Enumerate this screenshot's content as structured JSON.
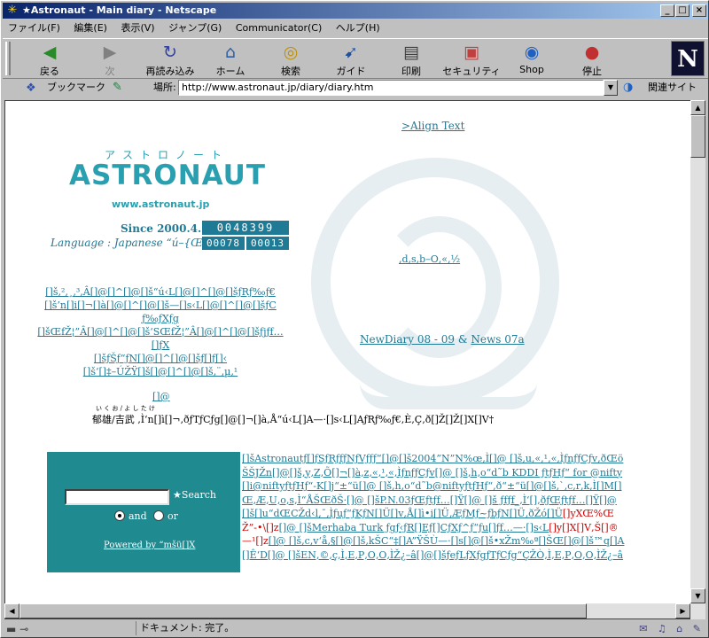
{
  "window": {
    "title": "★Astronaut - Main diary - Netscape",
    "buttons": {
      "minimize": "_",
      "maximize": "□",
      "close": "×"
    }
  },
  "menu": [
    "ファイル(F)",
    "編集(E)",
    "表示(V)",
    "ジャンプ(G)",
    "Communicator(C)",
    "ヘルプ(H)"
  ],
  "toolbar": {
    "back": "戻る",
    "forward": "次",
    "reload": "再読み込み",
    "home": "ホーム",
    "search": "検索",
    "guide": "ガイド",
    "print": "印刷",
    "security": "セキュリティ",
    "shop": "Shop",
    "stop": "停止",
    "brand": "N"
  },
  "location": {
    "bookmarks": "ブックマーク",
    "label": "場所:",
    "url": "http://www.astronaut.jp/diary/diary.htm",
    "related": "関連サイト"
  },
  "status": {
    "text": "ドキュメント: 完了。"
  },
  "page": {
    "align_text": ">Align Text",
    "logo": {
      "kana": "アストロノート",
      "wordmark": "ASTRONAUT",
      "site": "www.astronaut.jp"
    },
    "since": "Since 2000.4.1",
    "counter": "0048399",
    "language": "Language : Japanese “ú–{Œê",
    "counter_today": "00078",
    "counter_yesterday": "00013",
    "menu_links": [
      "[]š‚²‚¸‚³‚Â[]@[]^[]@[]š“ú‹L[]@[]^[]@[]šƒRƒ‰ƒ€",
      "[]š’n[]i[]¬[]à[]@[]^[]@[]š—[]s‹L[]@[]^[]@[]šƒC",
      "ƒ‰ƒXƒg",
      "[]šŒfŽ¦”Â[]@[]^[]@[]š‘SŒfŽ¦”Â[]@[]^[]@[]šƒjƒf…",
      "[]ƒX",
      "[]šƒŠƒ“ƒN[]@[]^[]@[]šƒ[]ƒ[]‹",
      "[]š‘[]‡–ÚŽŸ[]š[]@[]^[]@[]š‚¨‚µ‚¹"
    ],
    "mark": "[]@",
    "ruby": "い く お / よ し た け",
    "signature": "郁雄/吉武 ‚Ì‘n[]ì[]¬‚ðƒTƒCƒg[]@[]¬[]à‚Å“ú‹L[]A—·[]s‹L[]AƒRƒ‰ƒ€,È‚Ç‚ð[]Ž[]Ž[]X[]V†",
    "center_link1": "‚d‚s‚b–O‚«‚½",
    "center_link2_a": "NewDiary 08 - 09",
    "center_link2_sep": " & ",
    "center_link2_b": "News 07a",
    "search": {
      "button": "★Search",
      "and": "and",
      "or": "or",
      "powered": "Powered by “mšü[]X"
    },
    "news_a": "[]šAstronautƒ[]ƒSƒRƒfƒNƒVƒƒƒ“[]@[]š2004”N”N%œ‚Ì[]@ []š‚u‚«‚¹‚«‚ÌƒnƒƒCƒv‚ðŒöŠŠJŽn[]@[]š‚y‚Z‚Õ[]¬[]à‚z‚«‚¹‚«‚ÌƒnƒƒCƒv[]@ []š‚h‚o“d˜b KDDI ƒtƒHƒ“ for @nifty[]i@niftyƒtƒHƒ“-K[]j“±“ü[]@ []š‚h‚o“d˜b@niftyƒtƒHƒ“‚ð“±“ü[]@[]š‚`‚c‚r‚k‚Ì[]M[]Œ‚Æ‚U‚o‚s‚Ì“ÅŠŒðŠ·[]@ []šP.N.03ƒŒƒtƒf…[]Ÿ[]@ []š ƒfƒf_‚Ì‘[]‚ðƒŒƒtƒf…[]Ÿ[]@ []š[]u“dŒCŽd‹l‚¯‚Ìƒuƒ“ƒKƒN[]Ü[]v‚Å[]ì•i[]Ü‚ÆƒMƒ~ƒbƒN[]Ü‚ðŽó[]Ü",
    "news_red": "[]yXŒ%ŒŽ”-•\\[]z",
    "news_b": "[]@ []šMerhaba Turk ƒgƒ‹ƒR[]Eƒ[]CƒXƒ^ƒ“ƒu[]ƒf…—·[]s‹L",
    "news_red2": "[]y[]X[]V‚Š[]®—¹[]z",
    "news_c": "[]@ []š‚c‚v‘å‚§[]@[]š‚kŠC“‡[]A”ŸŠÙ—·[]s[]@[]š•xŽm‰ª[]ŠŒ[]@[]š™q[]A[]Ê‘D[]@ []šEN‚©‚ç‚Ì‚E‚P‚O‚O‚ÌŽ¿–â[]@[]šƒeƒLƒXƒgƒTƒCƒg“ÇŽÒ‚Ì‚E‚P‚O‚O‚ÌŽ¿–â"
  },
  "colors": {
    "link": "#1f7a96",
    "title_bar": "#0a246a",
    "search_box": "#1f8a90",
    "alert": "#d00000"
  }
}
